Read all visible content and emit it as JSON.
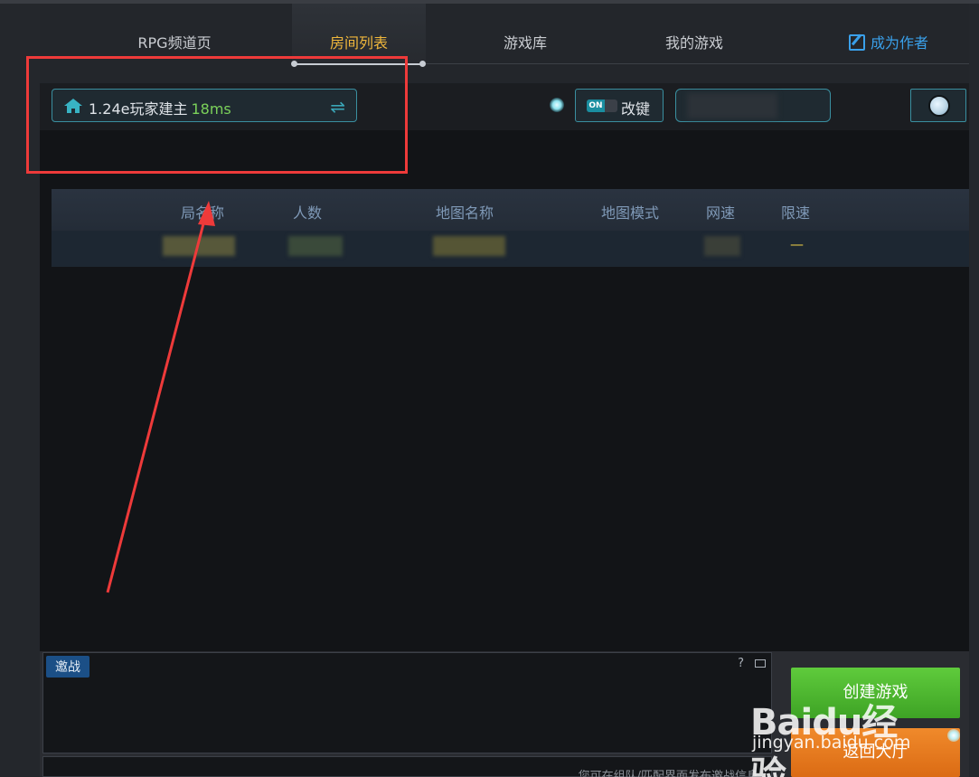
{
  "nav": {
    "tabs": [
      {
        "label": "RPG频道页",
        "active": false
      },
      {
        "label": "房间列表",
        "active": true
      },
      {
        "label": "游戏库",
        "active": false
      },
      {
        "label": "我的游戏",
        "active": false
      },
      {
        "label": "成为作者",
        "active": false
      }
    ]
  },
  "toolbar": {
    "server_name": "1.24e玩家建主",
    "server_ping": "18ms",
    "toggle_text": "ON",
    "keymap_label": "改键"
  },
  "table": {
    "columns": [
      "局名称",
      "人数",
      "地图名称",
      "地图模式",
      "网速",
      "限速"
    ],
    "rows": [
      {
        "speed_limit": "—"
      }
    ]
  },
  "chat": {
    "tag": "邀战",
    "help": "?",
    "hint": "您可在组队/匹配界面发布邀战信息"
  },
  "actions": {
    "create_game": "创建游戏",
    "back_to_lobby": "返回大厅"
  },
  "watermark": {
    "logo": "Baidu经验",
    "url": "jingyan.baidu.com"
  },
  "colors": {
    "accent_active_tab": "#f0b73c",
    "ping_green": "#7bd15a",
    "border_teal": "#3a8fa0",
    "create_green": "#4fb82f",
    "back_orange": "#e87a20",
    "annotation_red": "#ee3a3a"
  }
}
